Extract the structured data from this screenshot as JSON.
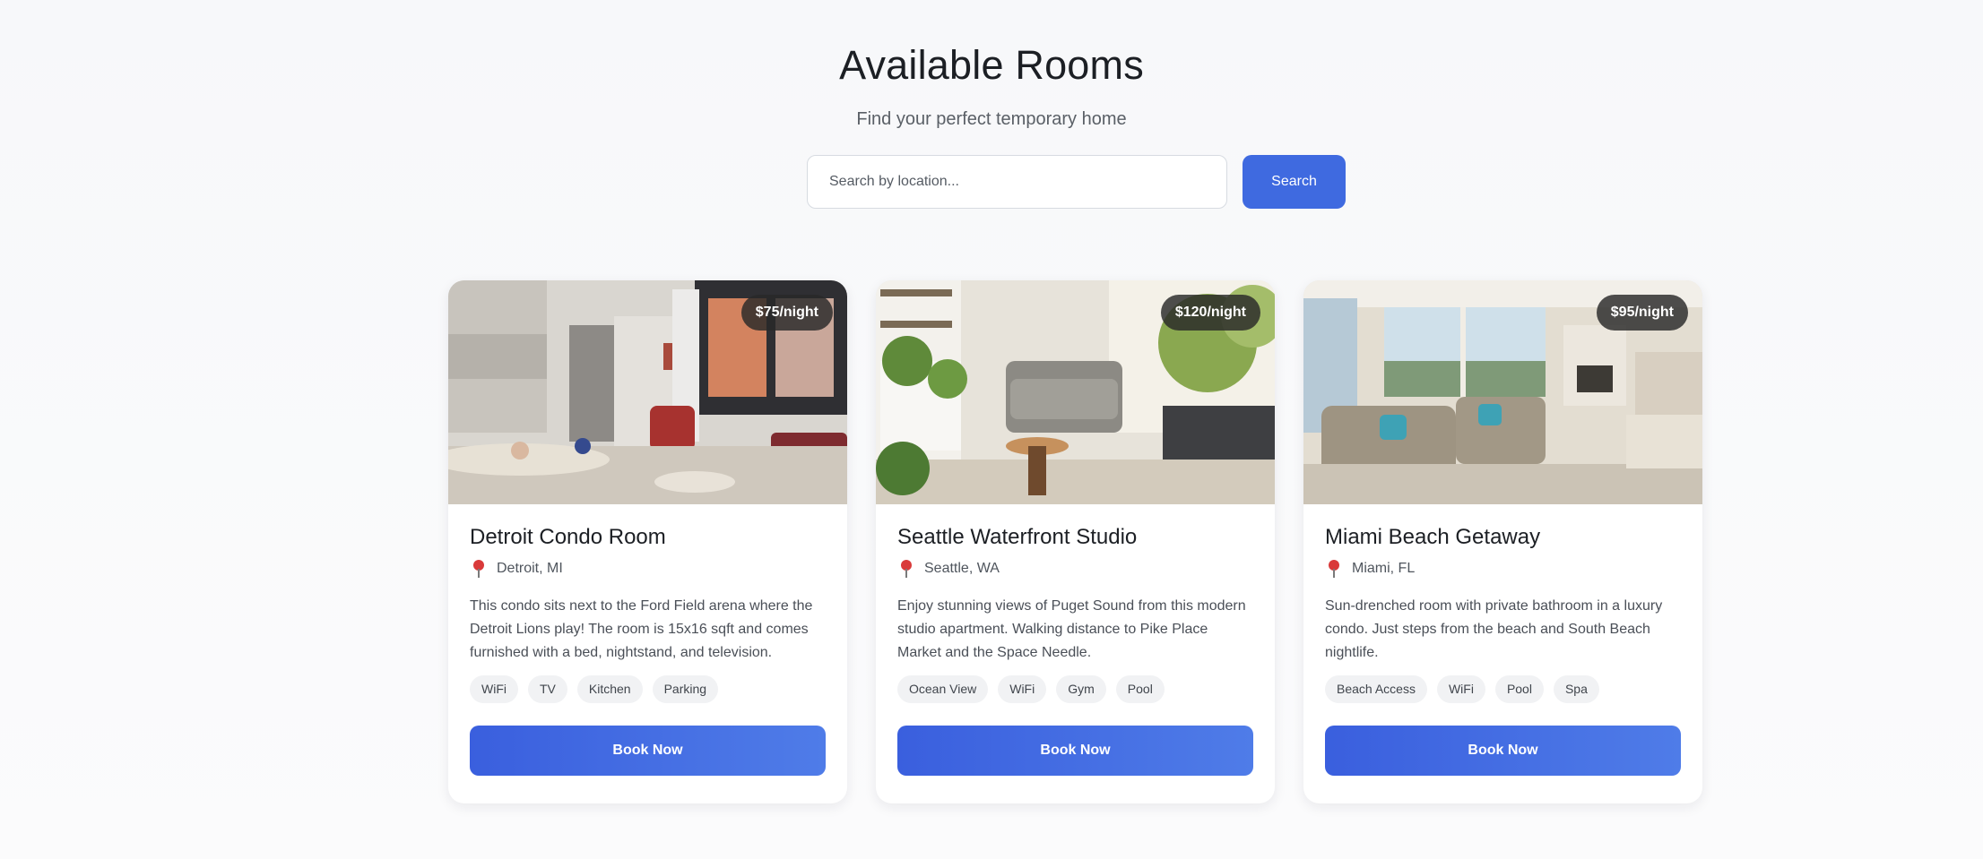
{
  "page": {
    "title": "Available Rooms",
    "subtitle": "Find your perfect temporary home"
  },
  "search": {
    "placeholder": "Search by location...",
    "button_label": "Search"
  },
  "colors": {
    "accent": "#3f6ae0",
    "badge_bg": "#333333",
    "tag_bg": "#f1f2f4"
  },
  "rooms": [
    {
      "title": "Detroit Condo Room",
      "price": "$75/night",
      "location": "Detroit, MI",
      "location_icon": "map-pin-icon",
      "description": "This condo sits next to the Ford Field arena where the Detroit Lions play! The room is 15x16 sqft and comes furnished with a bed, nightstand, and television.",
      "amenities": [
        "WiFi",
        "TV",
        "Kitchen",
        "Parking"
      ],
      "button_label": "Book Now"
    },
    {
      "title": "Seattle Waterfront Studio",
      "price": "$120/night",
      "location": "Seattle, WA",
      "location_icon": "map-pin-icon",
      "description": "Enjoy stunning views of Puget Sound from this modern studio apartment. Walking distance to Pike Place Market and the Space Needle.",
      "amenities": [
        "Ocean View",
        "WiFi",
        "Gym",
        "Pool"
      ],
      "button_label": "Book Now"
    },
    {
      "title": "Miami Beach Getaway",
      "price": "$95/night",
      "location": "Miami, FL",
      "location_icon": "map-pin-icon",
      "description": "Sun-drenched room with private bathroom in a luxury condo. Just steps from the beach and South Beach nightlife.",
      "amenities": [
        "Beach Access",
        "WiFi",
        "Pool",
        "Spa"
      ],
      "button_label": "Book Now"
    }
  ]
}
